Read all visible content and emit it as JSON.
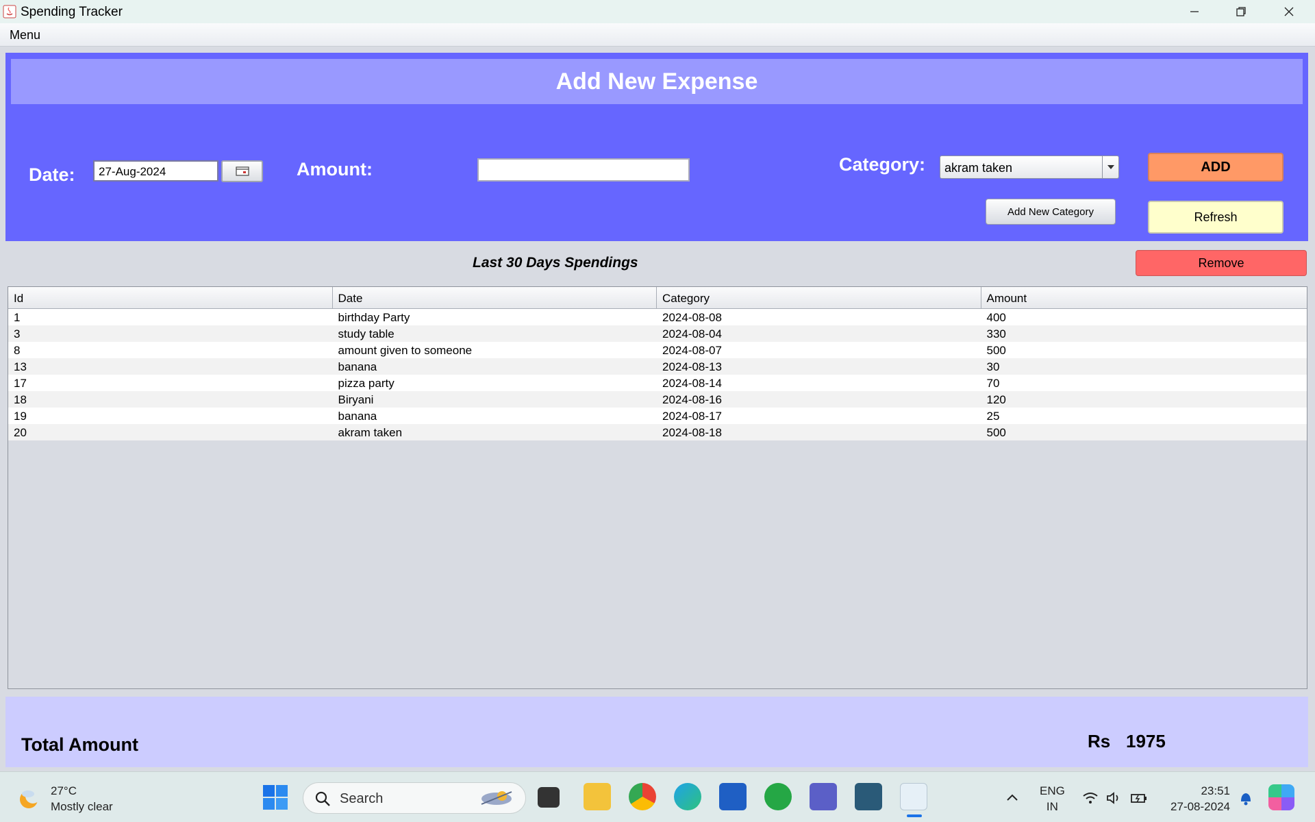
{
  "window": {
    "title": "Spending Tracker",
    "menu": "Menu"
  },
  "form": {
    "heading": "Add New Expense",
    "date_label": "Date:",
    "date_value": "27-Aug-2024",
    "amount_label": "Amount:",
    "amount_value": "",
    "category_label": "Category:",
    "category_value": "akram taken",
    "add_label": "ADD",
    "add_category_label": "Add New Category",
    "refresh_label": "Refresh"
  },
  "list": {
    "title": "Last 30 Days Spendings",
    "remove_label": "Remove",
    "columns": [
      "Id",
      "Date",
      "Category",
      "Amount"
    ],
    "rows": [
      [
        "1",
        "birthday Party",
        "2024-08-08",
        "400"
      ],
      [
        "3",
        "study table",
        "2024-08-04",
        "330"
      ],
      [
        "8",
        "amount given to someone",
        "2024-08-07",
        "500"
      ],
      [
        "13",
        "banana",
        "2024-08-13",
        "30"
      ],
      [
        "17",
        "pizza party",
        "2024-08-14",
        "70"
      ],
      [
        "18",
        "Biryani",
        "2024-08-16",
        "120"
      ],
      [
        "19",
        "banana",
        "2024-08-17",
        "25"
      ],
      [
        "20",
        "akram taken",
        "2024-08-18",
        "500"
      ]
    ]
  },
  "total": {
    "label": "Total Amount",
    "prefix": "Rs",
    "value": "1975"
  },
  "taskbar": {
    "weather_temp": "27°C",
    "weather_desc": "Mostly clear",
    "search_label": "Search",
    "lang_1": "ENG",
    "lang_2": "IN",
    "time": "23:51",
    "date": "27-08-2024"
  },
  "colors": {
    "form_bg": "#6666ff",
    "heading_band": "#9999ff",
    "add_button": "#ff9966",
    "refresh_button": "#ffffcc",
    "remove_button": "#ff6666",
    "total_bg": "#ccccff"
  }
}
